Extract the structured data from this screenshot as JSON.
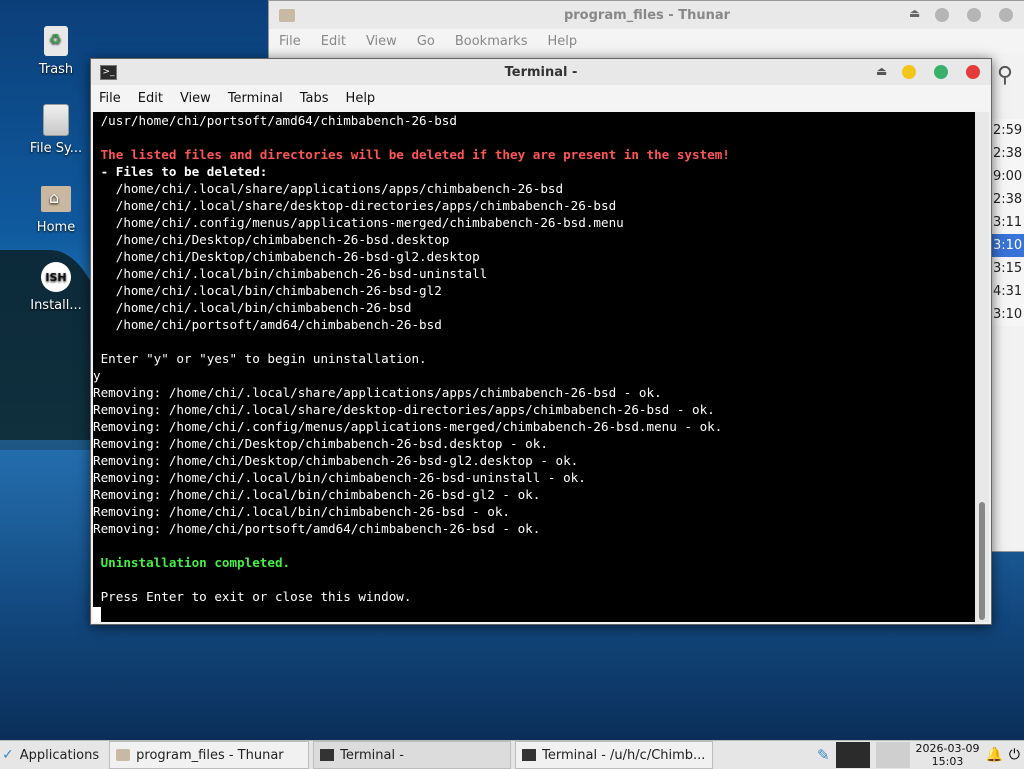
{
  "desktop": {
    "icons": [
      {
        "label": "Trash"
      },
      {
        "label": "File Sy..."
      },
      {
        "label": "Home"
      },
      {
        "label": "Install..."
      }
    ],
    "ish_icon_text": "ISH"
  },
  "thunar": {
    "title": "program_files - Thunar",
    "menu": [
      "File",
      "Edit",
      "View",
      "Go",
      "Bookmarks",
      "Help"
    ],
    "times": [
      "2:59",
      "2:38",
      "9:00",
      "2:38",
      "3:11",
      "3:10",
      "3:15",
      "4:31",
      "3:10"
    ]
  },
  "terminal": {
    "title": "Terminal -",
    "menu": [
      "File",
      "Edit",
      "View",
      "Terminal",
      "Tabs",
      "Help"
    ],
    "lines": [
      {
        "text": " /usr/home/chi/portsoft/amd64/chimbabench-26-bsd",
        "style": ""
      },
      {
        "text": "",
        "style": ""
      },
      {
        "text": " The listed files and directories will be deleted if they are present in the system!",
        "style": "red"
      },
      {
        "text": " - Files to be deleted:",
        "style": "b"
      },
      {
        "text": "   /home/chi/.local/share/applications/apps/chimbabench-26-bsd",
        "style": ""
      },
      {
        "text": "   /home/chi/.local/share/desktop-directories/apps/chimbabench-26-bsd",
        "style": ""
      },
      {
        "text": "   /home/chi/.config/menus/applications-merged/chimbabench-26-bsd.menu",
        "style": ""
      },
      {
        "text": "   /home/chi/Desktop/chimbabench-26-bsd.desktop",
        "style": ""
      },
      {
        "text": "   /home/chi/Desktop/chimbabench-26-bsd-gl2.desktop",
        "style": ""
      },
      {
        "text": "   /home/chi/.local/bin/chimbabench-26-bsd-uninstall",
        "style": ""
      },
      {
        "text": "   /home/chi/.local/bin/chimbabench-26-bsd-gl2",
        "style": ""
      },
      {
        "text": "   /home/chi/.local/bin/chimbabench-26-bsd",
        "style": ""
      },
      {
        "text": "   /home/chi/portsoft/amd64/chimbabench-26-bsd",
        "style": ""
      },
      {
        "text": "",
        "style": ""
      },
      {
        "text": " Enter \"y\" or \"yes\" to begin uninstallation.",
        "style": "prompt"
      },
      {
        "text": "y",
        "style": ""
      },
      {
        "text": "Removing: /home/chi/.local/share/applications/apps/chimbabench-26-bsd - ok.",
        "style": ""
      },
      {
        "text": "Removing: /home/chi/.local/share/desktop-directories/apps/chimbabench-26-bsd - ok.",
        "style": ""
      },
      {
        "text": "Removing: /home/chi/.config/menus/applications-merged/chimbabench-26-bsd.menu - ok.",
        "style": ""
      },
      {
        "text": "Removing: /home/chi/Desktop/chimbabench-26-bsd.desktop - ok.",
        "style": ""
      },
      {
        "text": "Removing: /home/chi/Desktop/chimbabench-26-bsd-gl2.desktop - ok.",
        "style": ""
      },
      {
        "text": "Removing: /home/chi/.local/bin/chimbabench-26-bsd-uninstall - ok.",
        "style": ""
      },
      {
        "text": "Removing: /home/chi/.local/bin/chimbabench-26-bsd-gl2 - ok.",
        "style": ""
      },
      {
        "text": "Removing: /home/chi/.local/bin/chimbabench-26-bsd - ok.",
        "style": ""
      },
      {
        "text": "Removing: /home/chi/portsoft/amd64/chimbabench-26-bsd - ok.",
        "style": ""
      },
      {
        "text": "",
        "style": ""
      },
      {
        "text": " Uninstallation completed.",
        "style": "green"
      },
      {
        "text": "",
        "style": ""
      },
      {
        "text": " Press Enter to exit or close this window.",
        "style": ""
      }
    ]
  },
  "taskbar": {
    "applications_label": "Applications",
    "tasks": [
      {
        "label": "program_files - Thunar"
      },
      {
        "label": "Terminal -"
      },
      {
        "label": "Terminal - /u/h/c/Chimb..."
      }
    ],
    "date": "2026-03-09",
    "time": "15:03"
  },
  "colors": {
    "accent": "#3874d8",
    "error_text": "#ff5555",
    "success_text": "#44ee44",
    "minimize": "#f5c518",
    "maximize": "#3ab06a",
    "close": "#e33b3b"
  }
}
